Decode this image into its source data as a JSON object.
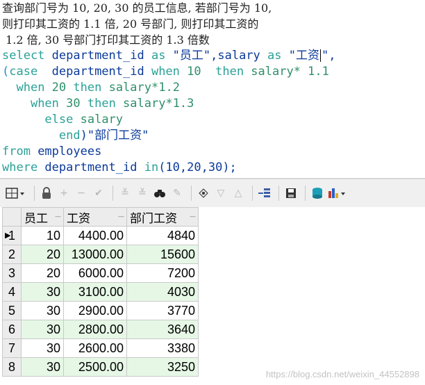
{
  "question": {
    "line1": "查询部门号为 10, 20, 30 的员工信息, 若部门号为 10,",
    "line2": "则打印其工资的 1.1 倍, 20 号部门, 则打印其工资的",
    "line3": " 1.2 倍, 30 号部门打印其工资的 1.3 倍数"
  },
  "sql": {
    "l1_kw_select": "select",
    "l1_col": " department_id ",
    "l1_kw_as1": "as",
    "l1_alias1": " \"员工\",salary ",
    "l1_kw_as2": "as",
    "l1_alias2a": " \"工资",
    "l1_alias2b": "\",",
    "l2_paren": "(",
    "l2_kw_case": "case",
    "l2_col": "  department_id ",
    "l2_kw_when": "when",
    "l2_num": " 10  ",
    "l2_kw_then": "then",
    "l2_expr": " salary* 1.1",
    "l3_indent": "  ",
    "l3_kw_when": "when",
    "l3_num": " 20 ",
    "l3_kw_then": "then",
    "l3_expr": " salary*1.2",
    "l4_indent": "    ",
    "l4_kw_when": "when",
    "l4_num": " 30 ",
    "l4_kw_then": "then",
    "l4_expr": " salary*1.3",
    "l5_indent": "      ",
    "l5_kw_else": "else",
    "l5_expr": " salary",
    "l6_indent": "        ",
    "l6_kw_end": "end",
    "l6_alias": ")\"部门工资\"",
    "l7_kw_from": "from",
    "l7_table": " employees",
    "l8_kw_where": "where",
    "l8_col": " department_id ",
    "l8_kw_in": "in",
    "l8_vals": "(10,20,30);"
  },
  "toolbar": {
    "icons": [
      "grid-menu-icon",
      "lock-icon",
      "add-row-icon",
      "delete-row-icon",
      "post-icon",
      "filter-icon",
      "filter-clear-icon",
      "find-icon",
      "clear-icon",
      "export-icon",
      "sort-down-icon",
      "sort-up-icon",
      "query-by-example-icon",
      "save-icon",
      "database-icon",
      "chart-icon"
    ]
  },
  "grid": {
    "headers": [
      "员工",
      "工资",
      "部门工资"
    ],
    "rows": [
      {
        "num": "1",
        "emp": "10",
        "salary": "4400.00",
        "dept_salary": "4840"
      },
      {
        "num": "2",
        "emp": "20",
        "salary": "13000.00",
        "dept_salary": "15600"
      },
      {
        "num": "3",
        "emp": "20",
        "salary": "6000.00",
        "dept_salary": "7200"
      },
      {
        "num": "4",
        "emp": "30",
        "salary": "3100.00",
        "dept_salary": "4030"
      },
      {
        "num": "5",
        "emp": "30",
        "salary": "2900.00",
        "dept_salary": "3770"
      },
      {
        "num": "6",
        "emp": "30",
        "salary": "2800.00",
        "dept_salary": "3640"
      },
      {
        "num": "7",
        "emp": "30",
        "salary": "2600.00",
        "dept_salary": "3380"
      },
      {
        "num": "8",
        "emp": "30",
        "salary": "2500.00",
        "dept_salary": "3250"
      }
    ]
  },
  "watermark": "https://blog.csdn.net/weixin_44552898"
}
